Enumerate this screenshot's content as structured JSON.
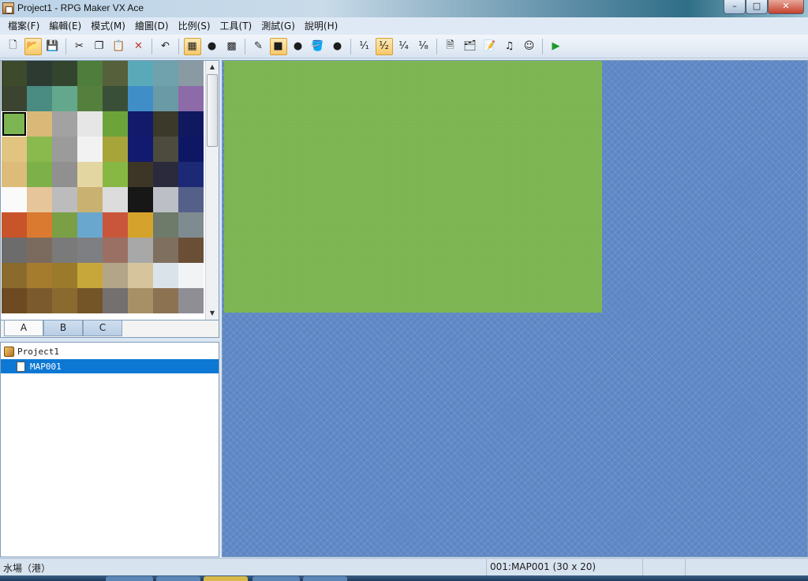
{
  "window": {
    "title": "Project1 - RPG Maker VX Ace",
    "controls": {
      "minimize": "–",
      "maximize": "□",
      "close": "✕"
    }
  },
  "menu": [
    "檔案(F)",
    "編輯(E)",
    "模式(M)",
    "繪圖(D)",
    "比例(S)",
    "工具(T)",
    "測試(G)",
    "說明(H)"
  ],
  "toolbar": [
    {
      "name": "new-project-icon",
      "glyph": "🗋"
    },
    {
      "name": "open-project-icon",
      "glyph": "📂",
      "active": true
    },
    {
      "name": "save-project-icon",
      "glyph": "💾"
    },
    {
      "sep": true
    },
    {
      "name": "cut-icon",
      "glyph": "✂"
    },
    {
      "name": "copy-icon",
      "glyph": "❐"
    },
    {
      "name": "paste-icon",
      "glyph": "📋"
    },
    {
      "name": "delete-icon",
      "glyph": "✕"
    },
    {
      "sep": true
    },
    {
      "name": "undo-icon",
      "glyph": "↶"
    },
    {
      "sep": true
    },
    {
      "name": "map-mode-icon",
      "glyph": "▦",
      "active": true
    },
    {
      "name": "event-mode-icon",
      "glyph": "●"
    },
    {
      "name": "region-mode-icon",
      "glyph": "▩"
    },
    {
      "sep": true
    },
    {
      "name": "pencil-icon",
      "glyph": "✎"
    },
    {
      "name": "rectangle-icon",
      "glyph": "■",
      "active": true
    },
    {
      "name": "ellipse-icon",
      "glyph": "●"
    },
    {
      "name": "fill-icon",
      "glyph": "🪣"
    },
    {
      "name": "shadow-pen-icon",
      "glyph": "●"
    },
    {
      "sep": true
    },
    {
      "name": "scale-1-1-icon",
      "glyph": "¹⁄₁"
    },
    {
      "name": "scale-1-2-icon",
      "glyph": "¹⁄₂",
      "active": true
    },
    {
      "name": "scale-1-4-icon",
      "glyph": "¹⁄₄"
    },
    {
      "name": "scale-1-8-icon",
      "glyph": "¹⁄₈"
    },
    {
      "sep": true
    },
    {
      "name": "database-icon",
      "glyph": "🗎"
    },
    {
      "name": "resource-manager-icon",
      "glyph": "🗂"
    },
    {
      "name": "script-editor-icon",
      "glyph": "📝"
    },
    {
      "name": "sound-test-icon",
      "glyph": "♫"
    },
    {
      "name": "character-generator-icon",
      "glyph": "☺"
    },
    {
      "sep": true
    },
    {
      "name": "playtest-icon",
      "glyph": "▶"
    }
  ],
  "tileset": {
    "tabs": [
      "A",
      "B",
      "C"
    ],
    "active_tab": "A",
    "selected_tile_index": 16,
    "tile_colors": [
      "#3d4a2c",
      "#2c3a32",
      "#33452f",
      "#4f7d3b",
      "#56603a",
      "#5aa9b9",
      "#6fa2ac",
      "#8a9aa2",
      "#3b4430",
      "#4a8b82",
      "#63a88d",
      "#557f3d",
      "#3a4f37",
      "#3f8ec7",
      "#6a9aa6",
      "#8d6aa8",
      "#7cb552",
      "#d9b878",
      "#a2a2a2",
      "#e6e6e6",
      "#6ca43a",
      "#141a6b",
      "#3b3a2a",
      "#101860",
      "#e2c481",
      "#8ab94e",
      "#9b9b9b",
      "#f2f2f2",
      "#a7a43a",
      "#121a6f",
      "#4c4b3d",
      "#0e1763",
      "#dcbc78",
      "#7eb04a",
      "#909090",
      "#e3d6a0",
      "#87b843",
      "#3d3525",
      "#2a2a3c",
      "#1c2a75",
      "#fafafa",
      "#e6c59a",
      "#bcbcbc",
      "#c9b171",
      "#dcdcdc",
      "#171717",
      "#bcc0c6",
      "#55608a",
      "#c8542a",
      "#d97a30",
      "#7a9f44",
      "#6aa7cf",
      "#c9563a",
      "#d5a32c",
      "#6e7a6a",
      "#7e8b90",
      "#6c6c6c",
      "#7b6a5e",
      "#7a7a7a",
      "#7d7f82",
      "#9a7064",
      "#a8a8a8",
      "#7e6f5f",
      "#6a4f36",
      "#8a6b2d",
      "#a57c2e",
      "#9b7b2b",
      "#c8a73a",
      "#b3a588",
      "#d6c59c",
      "#dbe3ea",
      "#f1f3f5",
      "#6d4a22",
      "#7b5a2e",
      "#8b6a30",
      "#735528",
      "#747070",
      "#a89066",
      "#8d7252",
      "#8e8e94"
    ]
  },
  "map_tree": {
    "project": "Project1",
    "selected_map": "MAP001"
  },
  "map": {
    "background_color": "#5d86c4",
    "ground_color": "#7cb552"
  },
  "status": {
    "tile_info": "水場（港）",
    "map_info": "001:MAP001 (30 x 20)"
  }
}
